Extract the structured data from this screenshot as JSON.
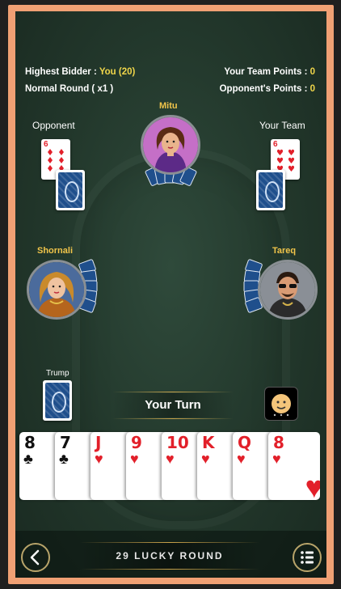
{
  "header": {
    "highest_bidder_label": "Highest Bidder : ",
    "highest_bidder_value": "You (20)",
    "round_type": "Normal Round ( x1 )",
    "team_points_label": "Your Team Points : ",
    "team_points_value": "0",
    "opponent_points_label": "Opponent's Points : ",
    "opponent_points_value": "0"
  },
  "players": {
    "top": {
      "name": "Mitu"
    },
    "left": {
      "name": "Shornali"
    },
    "right": {
      "name": "Tareq"
    }
  },
  "piles": {
    "opponent": {
      "label": "Opponent",
      "rank": "6",
      "suit": "♦"
    },
    "team": {
      "label": "Your Team",
      "rank": "6",
      "suit": "♥"
    }
  },
  "trump_label": "Trump",
  "turn_text": "Your Turn",
  "hand": [
    {
      "rank": "8",
      "suit": "♣",
      "color": "black"
    },
    {
      "rank": "7",
      "suit": "♣",
      "color": "black"
    },
    {
      "rank": "J",
      "suit": "♥",
      "color": "red"
    },
    {
      "rank": "9",
      "suit": "♥",
      "color": "red"
    },
    {
      "rank": "10",
      "suit": "♥",
      "color": "red"
    },
    {
      "rank": "K",
      "suit": "♥",
      "color": "red"
    },
    {
      "rank": "Q",
      "suit": "♥",
      "color": "red"
    },
    {
      "rank": "8",
      "suit": "♥",
      "color": "red"
    }
  ],
  "round_title": "29 LUCKY ROUND",
  "icons": {
    "back": "back-arrow-icon",
    "menu": "menu-list-icon",
    "emoji": "emoji-icon"
  }
}
